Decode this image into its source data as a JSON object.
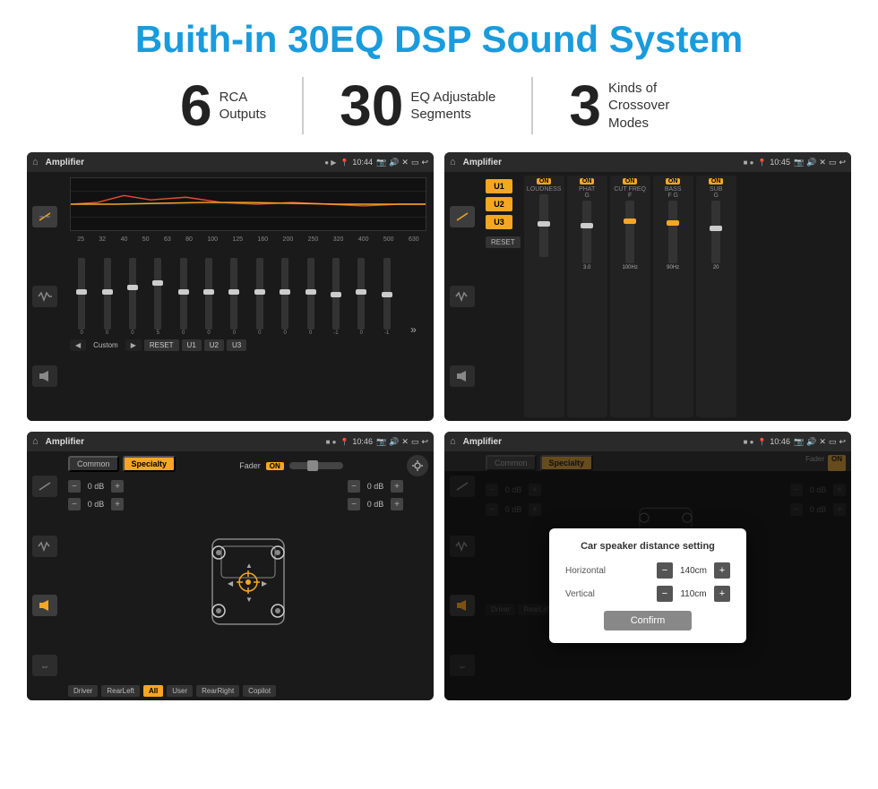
{
  "page": {
    "title": "Buith-in 30EQ DSP Sound System",
    "bg_color": "#ffffff"
  },
  "stats": [
    {
      "number": "6",
      "text": "RCA\nOutputs"
    },
    {
      "number": "30",
      "text": "EQ Adjustable\nSegments"
    },
    {
      "number": "3",
      "text": "Kinds of\nCrossover Modes"
    }
  ],
  "screens": [
    {
      "id": "screen-eq",
      "status_bar": {
        "home": "⌂",
        "title": "Amplifier",
        "dots": "● ▶",
        "time": "10:44",
        "icons": "📷 🔊 ✕ ▭ ↩"
      }
    },
    {
      "id": "screen-amp",
      "status_bar": {
        "home": "⌂",
        "title": "Amplifier",
        "dots": "■ ●",
        "time": "10:45",
        "icons": "📷 🔊 ✕ ▭ ↩"
      }
    },
    {
      "id": "screen-cross",
      "status_bar": {
        "home": "⌂",
        "title": "Amplifier",
        "dots": "■ ●",
        "time": "10:46",
        "icons": "📷 🔊 ✕ ▭ ↩"
      }
    },
    {
      "id": "screen-dialog",
      "status_bar": {
        "home": "⌂",
        "title": "Amplifier",
        "dots": "■ ●",
        "time": "10:46",
        "icons": "📷 🔊 ✕ ▭ ↩"
      },
      "dialog": {
        "title": "Car speaker distance setting",
        "horizontal_label": "Horizontal",
        "horizontal_value": "140cm",
        "vertical_label": "Vertical",
        "vertical_value": "110cm",
        "confirm_label": "Confirm"
      }
    }
  ],
  "eq": {
    "frequencies": [
      "25",
      "32",
      "40",
      "50",
      "63",
      "80",
      "100",
      "125",
      "160",
      "200",
      "250",
      "320",
      "400",
      "500",
      "630"
    ],
    "values": [
      "0",
      "0",
      "0",
      "5",
      "0",
      "0",
      "0",
      "0",
      "0",
      "0",
      "-1",
      "0",
      "-1"
    ],
    "presets": [
      "Custom",
      "RESET",
      "U1",
      "U2",
      "U3"
    ]
  },
  "amp": {
    "channels": [
      {
        "name": "LOUDNESS",
        "on": true
      },
      {
        "name": "PHAT",
        "on": true
      },
      {
        "name": "CUT FREQ",
        "on": true
      },
      {
        "name": "BASS",
        "on": true
      },
      {
        "name": "SUB",
        "on": true
      }
    ],
    "u_buttons": [
      "U1",
      "U2",
      "U3"
    ],
    "reset_label": "RESET"
  },
  "cross": {
    "tabs": [
      "Common",
      "Specialty"
    ],
    "active_tab": "Specialty",
    "fader_label": "Fader",
    "fader_on": "ON",
    "db_values": [
      "0 dB",
      "0 dB",
      "0 dB",
      "0 dB"
    ],
    "bottom_buttons": [
      "Driver",
      "RearLeft",
      "All",
      "User",
      "RearRight",
      "Copilot"
    ]
  },
  "dialog": {
    "title": "Car speaker distance setting",
    "horizontal_label": "Horizontal",
    "horizontal_value": "140cm",
    "vertical_label": "Vertical",
    "vertical_value": "110cm",
    "confirm_label": "Confirm"
  }
}
